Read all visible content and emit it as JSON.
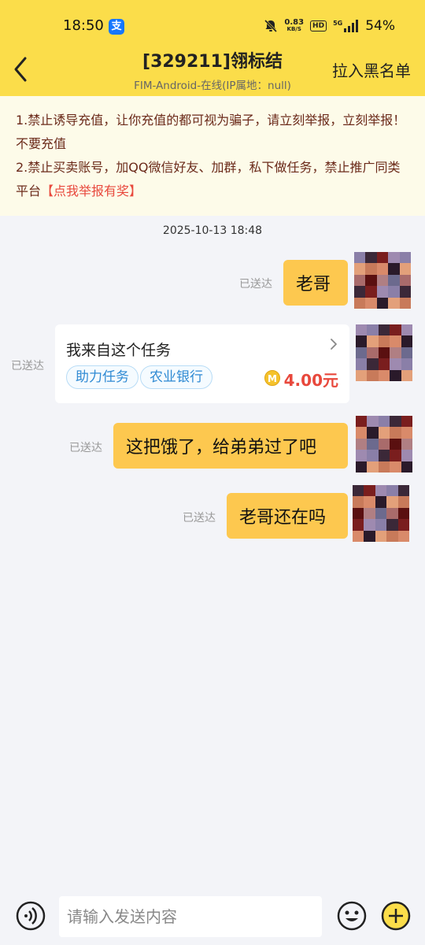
{
  "status_bar": {
    "time": "18:50",
    "net_speed_value": "0.83",
    "net_speed_unit": "KB/S",
    "hd": "HD",
    "network": "5G",
    "battery": "54%"
  },
  "header": {
    "title": "[329211]翎标结",
    "subtitle": "FIM-Android-在线(IP属地：null)",
    "blacklist_label": "拉入黑名单"
  },
  "notice": {
    "line1": "1.禁止诱导充值，让你充值的都可视为骗子，请立刻举报，立刻举报！不要充值",
    "line2": "2.禁止买卖账号，加QQ微信好友、加群，私下做任务，禁止推广同类平台",
    "report_link": "【点我举报有奖】"
  },
  "chat": {
    "timestamp": "2025-10-13 18:48",
    "messages": [
      {
        "status": "已送达",
        "text": "老哥"
      },
      {
        "status": "已送达",
        "card": {
          "title": "我来自这个任务",
          "tags": [
            "助力任务",
            "农业银行"
          ],
          "amount": "4.00元"
        }
      },
      {
        "status": "已送达",
        "text": "这把饿了，给弟弟过了吧"
      },
      {
        "status": "已送达",
        "text": "老哥还在吗"
      }
    ]
  },
  "input": {
    "placeholder": "请输入发送内容"
  },
  "icons": {
    "back": "chevron-left-icon",
    "voice": "voice-icon",
    "emoji": "emoji-icon",
    "plus": "plus-circle-icon",
    "coin": "coin-icon"
  },
  "colors": {
    "header_bg": "#fbdd4a",
    "bubble_bg": "#fdc84f",
    "notice_bg": "#fdfbe9",
    "alert_red": "#e8483c",
    "tag_blue": "#2f8ad3"
  }
}
